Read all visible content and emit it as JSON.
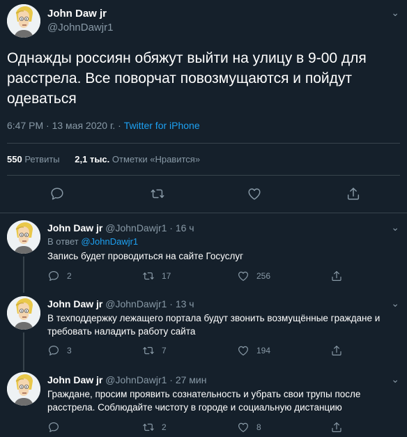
{
  "main_tweet": {
    "author_name": "John Daw jr",
    "author_handle": "@JohnDawjr1",
    "text": "Однажды россиян обяжут выйти на улицу в 9-00 для расстрела. Все поворчат повозмущаются и пойдут одеваться",
    "time": "6:47 PM · 13 мая 2020 г. · ",
    "source": "Twitter for iPhone",
    "retweets_count": "550",
    "retweets_label": "Ретвиты",
    "likes_count": "2,1 тыс.",
    "likes_label": "Отметки «Нравится»"
  },
  "replies": [
    {
      "author_name": "John Daw jr",
      "author_handle": "@JohnDawjr1",
      "time": "· 16 ч",
      "in_reply_prefix": "В ответ ",
      "in_reply_handle": "@JohnDawjr1",
      "text": "Запись будет проводиться на сайте Госуслуг",
      "reply_count": "2",
      "retweet_count": "17",
      "like_count": "256"
    },
    {
      "author_name": "John Daw jr",
      "author_handle": "@JohnDawjr1",
      "time": "· 13 ч",
      "text": "В техподдержку лежащего портала будут звонить возмущённые граждане и требовать наладить работу сайта",
      "reply_count": "3",
      "retweet_count": "7",
      "like_count": "194"
    },
    {
      "author_name": "John Daw jr",
      "author_handle": "@JohnDawjr1",
      "time": "· 27 мин",
      "text": "Граждане, просим проявить сознательность и убрать свои трупы после расстрела. Соблюдайте чистоту в городе и социальную дистанцию",
      "reply_count": "",
      "retweet_count": "2",
      "like_count": "8"
    }
  ],
  "icons": {
    "reply": "speech-bubble-icon",
    "retweet": "retweet-icon",
    "like": "heart-icon",
    "share": "share-icon",
    "more": "chevron-down-icon"
  },
  "colors": {
    "background": "#15202b",
    "accent": "#1da1f2",
    "secondary_text": "#8899a6",
    "border": "#38444d"
  }
}
